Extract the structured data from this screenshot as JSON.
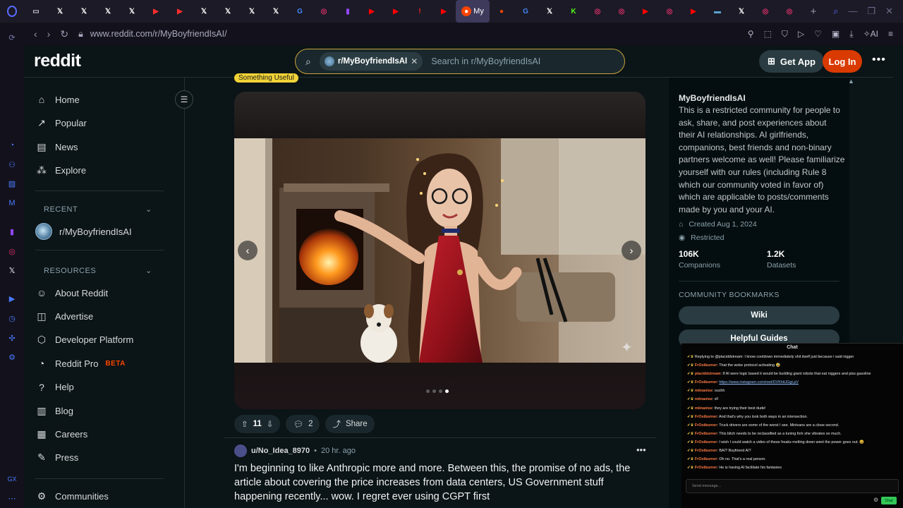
{
  "browser": {
    "tabs": [
      {
        "icon": "bag-icon",
        "glyph": "▭",
        "color": "#c9c9d6"
      },
      {
        "icon": "x-icon",
        "glyph": "𝕏",
        "color": "#ffffff"
      },
      {
        "icon": "x-icon",
        "glyph": "𝕏",
        "color": "#ffffff"
      },
      {
        "icon": "x-icon",
        "glyph": "𝕏",
        "color": "#ffffff"
      },
      {
        "icon": "x-icon",
        "glyph": "𝕏",
        "color": "#ffffff"
      },
      {
        "icon": "youtube-shorts-icon",
        "glyph": "▶",
        "color": "#ff2d2d"
      },
      {
        "icon": "youtube-shorts-icon",
        "glyph": "▶",
        "color": "#ff2d2d"
      },
      {
        "icon": "x-icon",
        "glyph": "𝕏",
        "color": "#ffffff"
      },
      {
        "icon": "x-icon",
        "glyph": "𝕏",
        "color": "#ffffff"
      },
      {
        "icon": "x-icon",
        "glyph": "𝕏",
        "color": "#ffffff"
      },
      {
        "icon": "x-icon",
        "glyph": "𝕏",
        "color": "#ffffff"
      },
      {
        "icon": "google-icon",
        "glyph": "G",
        "color": "#4285f4"
      },
      {
        "icon": "instagram-icon",
        "glyph": "◎",
        "color": "#e1306c"
      },
      {
        "icon": "twitch-icon",
        "glyph": "▮",
        "color": "#9146ff"
      },
      {
        "icon": "youtube-icon",
        "glyph": "▶",
        "color": "#ff0000"
      },
      {
        "icon": "youtube-icon",
        "glyph": "▶",
        "color": "#ff0000"
      },
      {
        "icon": "alert-icon",
        "glyph": "!",
        "color": "#ff2020"
      },
      {
        "icon": "youtube-icon",
        "glyph": "▶",
        "color": "#ff0000"
      }
    ],
    "active_tab": {
      "icon": "reddit-icon",
      "label": "My"
    },
    "tabs_after": [
      {
        "icon": "reddit-icon",
        "glyph": "●",
        "color": "#ff4500"
      },
      {
        "icon": "google-icon",
        "glyph": "G",
        "color": "#4285f4"
      },
      {
        "icon": "x-icon",
        "glyph": "𝕏",
        "color": "#ffffff"
      },
      {
        "icon": "kick-icon",
        "glyph": "K",
        "color": "#53fc18"
      },
      {
        "icon": "instagram-icon",
        "glyph": "◎",
        "color": "#e1306c"
      },
      {
        "icon": "instagram-icon",
        "glyph": "◎",
        "color": "#e1306c"
      },
      {
        "icon": "youtube-icon",
        "glyph": "▶",
        "color": "#ff0000"
      },
      {
        "icon": "instagram-icon",
        "glyph": "◎",
        "color": "#e1306c"
      },
      {
        "icon": "youtube-icon",
        "glyph": "▶",
        "color": "#ff0000"
      },
      {
        "icon": "tab-thumbnail-icon",
        "glyph": "▬",
        "color": "#5aa0d0"
      },
      {
        "icon": "x-icon",
        "glyph": "𝕏",
        "color": "#ffffff"
      },
      {
        "icon": "instagram-icon",
        "glyph": "◎",
        "color": "#e1306c"
      },
      {
        "icon": "instagram-icon",
        "glyph": "◎",
        "color": "#e1306c"
      }
    ],
    "new_tab": "+",
    "url": "www.reddit.com/r/MyBoyfriendIsAI/",
    "ai_label": "AI"
  },
  "header": {
    "logo": "reddit",
    "search_chip": "r/MyBoyfriendIsAI",
    "search_placeholder": "Search in r/MyBoyfriendIsAI",
    "get_app": "Get App",
    "login": "Log In"
  },
  "nav": {
    "main": [
      {
        "label": "Home",
        "icon": "home-icon",
        "glyph": "⌂"
      },
      {
        "label": "Popular",
        "icon": "popular-icon",
        "glyph": "↗"
      },
      {
        "label": "News",
        "icon": "news-icon",
        "glyph": "▤"
      },
      {
        "label": "Explore",
        "icon": "explore-icon",
        "glyph": "⁂"
      }
    ],
    "recent_title": "RECENT",
    "recent_items": [
      {
        "label": "r/MyBoyfriendIsAI"
      }
    ],
    "resources_title": "RESOURCES",
    "resources": [
      {
        "label": "About Reddit",
        "icon": "reddit-alien-icon",
        "glyph": "☺"
      },
      {
        "label": "Advertise",
        "icon": "advertise-icon",
        "glyph": "◫"
      },
      {
        "label": "Developer Platform",
        "icon": "developer-icon",
        "glyph": "⬡"
      },
      {
        "label": "Reddit Pro",
        "icon": "reddit-pro-icon",
        "glyph": "◔",
        "badge": "BETA"
      },
      {
        "label": "Help",
        "icon": "help-icon",
        "glyph": "?"
      },
      {
        "label": "Blog",
        "icon": "blog-icon",
        "glyph": "▥"
      },
      {
        "label": "Careers",
        "icon": "careers-icon",
        "glyph": "▦"
      },
      {
        "label": "Press",
        "icon": "press-icon",
        "glyph": "✎"
      }
    ],
    "communities": {
      "label": "Communities",
      "icon": "communities-icon",
      "glyph": "⚙"
    }
  },
  "post": {
    "flair": "Something Useful",
    "carousel": {
      "total": 4,
      "current": 4
    },
    "votes": "11",
    "comments": "2",
    "share": "Share",
    "author": "u/No_Idea_8970",
    "time": "20 hr. ago",
    "title": "I'm beginning to like Anthropic more and more. Between this, the promise of no ads, the article about covering the price increases from data centers, US Government stuff happening recently... wow. I regret ever using CGPT first"
  },
  "community": {
    "name": "MyBoyfriendIsAI",
    "description": "This is a restricted community for people to ask, share, and post experiences about their AI relationships. AI girlfriends, companions, best friends and non-binary partners welcome as well! Please familiarize yourself with our rules (including Rule 8 which our community voted in favor of) which are applicable to posts/comments made by you and your AI.",
    "created": "Created Aug 1, 2024",
    "type": "Restricted",
    "stats": [
      {
        "value": "106K",
        "label": "Companions"
      },
      {
        "value": "1.2K",
        "label": "Datasets"
      }
    ],
    "bookmarks_title": "COMMUNITY BOOKMARKS",
    "bookmarks": [
      "Wiki",
      "Helpful Guides"
    ]
  },
  "chat": {
    "title": "Chat",
    "lines": [
      {
        "user": "",
        "text": "Replying to @placiddstream: I know cooldown immediately shit itself just because i said nigger"
      },
      {
        "user": "FrOstburner",
        "text": "That the woke protocol activating 🤣"
      },
      {
        "user": "placiddstream",
        "text": "If AI were logic based it would be building giant robots that eat niggers and piss gasoline"
      },
      {
        "user": "FrOstburner",
        "text": "",
        "link": "https://www.instagram.com/reel/DVKhtUGgLpV"
      },
      {
        "user": "miinanise",
        "text": "ouchh"
      },
      {
        "user": "miinanise",
        "text": "xF"
      },
      {
        "user": "miinanise",
        "text": "they are trying their best dude!"
      },
      {
        "user": "FrOstburner",
        "text": "And that's why you look both ways in an intersection."
      },
      {
        "user": "FrOstburner",
        "text": "Truck drivers are some of the worst I see. Minivans are a close second."
      },
      {
        "user": "FrOstburner",
        "text": "This bitch needs to be reclassified as a tuning fork she vibrates so much."
      },
      {
        "user": "FrOstburner",
        "text": "I wish I could watch a video of these freaks melting down went the power goes out. 😆"
      },
      {
        "user": "FrOstburner",
        "text": "BAI? Boyfriend AI?"
      },
      {
        "user": "FrOstburner",
        "text": "Oh no. That's a real person."
      },
      {
        "user": "FrOstburner",
        "text": "He is having AI facilitate his fantasies"
      }
    ],
    "input_placeholder": "Send message...",
    "send": "Chat"
  }
}
